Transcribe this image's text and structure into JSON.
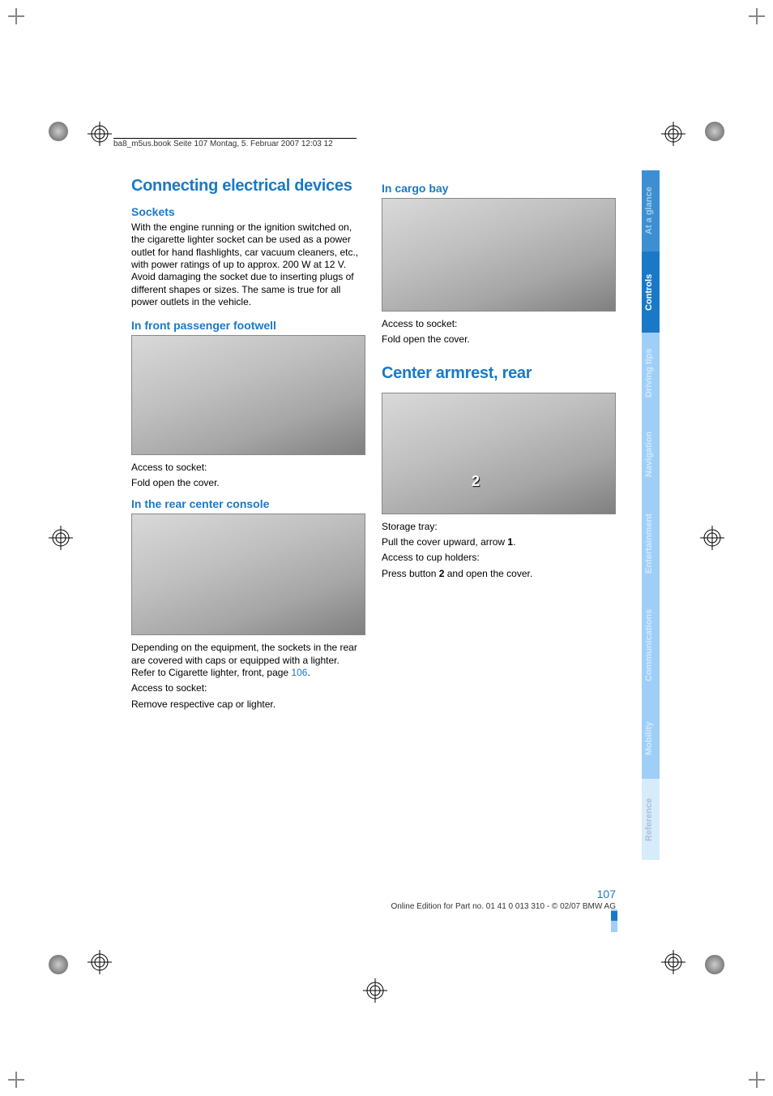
{
  "header_line": "ba8_m5us.book  Seite 107  Montag, 5. Februar 2007  12:03 12",
  "col1": {
    "h1": "Connecting electrical devices",
    "h2a": "Sockets",
    "p1": "With the engine running or the ignition switched on, the cigarette lighter socket can be used as a power outlet for hand flashlights, car vacuum cleaners, etc., with power ratings of up to approx. 200 W at 12 V. Avoid damaging the socket due to inserting plugs of different shapes or sizes. The same is true for all power outlets in the vehicle.",
    "h2b": "In front passenger footwell",
    "p2a": "Access to socket:",
    "p2b": "Fold open the cover.",
    "h2c": "In the rear center console",
    "p3a_pre": "Depending on the equipment, the sockets in the rear are covered with caps or equipped with a lighter. Refer to Cigarette lighter, front, page ",
    "p3a_ref": "106",
    "p3a_post": ".",
    "p3b": "Access to socket:",
    "p3c": "Remove respective cap or lighter."
  },
  "col2": {
    "h2a": "In cargo bay",
    "p1a": "Access to socket:",
    "p1b": "Fold open the cover.",
    "h1": "Center armrest, rear",
    "fig_num": "2",
    "p2a": "Storage tray:",
    "p2b_pre": "Pull the cover upward, arrow ",
    "p2b_bold": "1",
    "p2b_post": ".",
    "p3a": "Access to cup holders:",
    "p3b_pre": "Press button ",
    "p3b_bold": "2",
    "p3b_post": " and open the cover."
  },
  "tabs": {
    "a": "At a glance",
    "b": "Controls",
    "c": "Driving tips",
    "d": "Navigation",
    "e": "Entertainment",
    "f": "Communications",
    "g": "Mobility",
    "h": "Reference"
  },
  "footer": {
    "page": "107",
    "line": "Online Edition for Part no. 01 41 0 013 310 - © 02/07 BMW AG"
  }
}
